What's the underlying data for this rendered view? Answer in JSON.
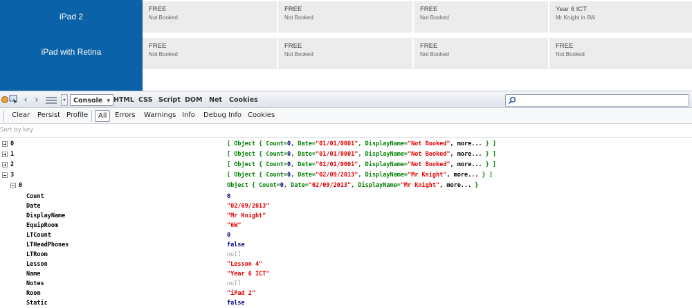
{
  "grid": {
    "devices": [
      {
        "name": "iPad 2",
        "cells": [
          {
            "status": "FREE",
            "sub": "Not Booked"
          },
          {
            "status": "FREE",
            "sub": "Not Booked"
          },
          {
            "status": "FREE",
            "sub": "Not Booked"
          },
          {
            "status": "Year 6 ICT",
            "sub": "Mr Knight in 6W"
          }
        ]
      },
      {
        "name": "iPad with Retina",
        "cells": [
          {
            "status": "FREE",
            "sub": "Not Booked"
          },
          {
            "status": "FREE",
            "sub": "Not Booked"
          },
          {
            "status": "FREE",
            "sub": "Not Booked"
          },
          {
            "status": "FREE",
            "sub": "Not Booked"
          }
        ]
      }
    ]
  },
  "toolbar": {
    "back_icon": "‹",
    "forward_icon": "›",
    "tabs": [
      "Console",
      "HTML",
      "CSS",
      "Script",
      "DOM",
      "Net",
      "Cookies"
    ],
    "console_dropdown": "▾"
  },
  "console_bar": {
    "buttons": [
      "Clear",
      "Persist",
      "Profile",
      "All",
      "Errors",
      "Warnings",
      "Info",
      "Debug Info",
      "Cookies"
    ]
  },
  "sort_label": "Sort by key",
  "tree": {
    "items": [
      {
        "key": "0",
        "summary": {
          "open": "[ ",
          "obj": "Object { ",
          "count_k": "Count=",
          "count_v": "0",
          "date_k": ",  Date=",
          "date_v": "\"01/01/0001\"",
          "dn_k": ",  DisplayName=",
          "dn_v": "\"Not Booked\"",
          "more": ",  more...",
          "close": " } ]"
        }
      },
      {
        "key": "1",
        "summary": {
          "open": "[ ",
          "obj": "Object { ",
          "count_k": "Count=",
          "count_v": "0",
          "date_k": ",  Date=",
          "date_v": "\"01/01/0001\"",
          "dn_k": ",  DisplayName=",
          "dn_v": "\"Not Booked\"",
          "more": ",  more...",
          "close": " } ]"
        }
      },
      {
        "key": "2",
        "summary": {
          "open": "[ ",
          "obj": "Object { ",
          "count_k": "Count=",
          "count_v": "0",
          "date_k": ",  Date=",
          "date_v": "\"01/01/0001\"",
          "dn_k": ",  DisplayName=",
          "dn_v": "\"Not Booked\"",
          "more": ",  more...",
          "close": " } ]"
        }
      },
      {
        "key": "3",
        "summary": {
          "open": "[ ",
          "obj": "Object { ",
          "count_k": "Count=",
          "count_v": "0",
          "date_k": ",  Date=",
          "date_v": "\"02/09/2013\"",
          "dn_k": ",  DisplayName=",
          "dn_v": "\"Mr Knight\"",
          "more": ",  more...",
          "close": " } ]"
        }
      }
    ],
    "expanded": {
      "key": "0",
      "summary": {
        "obj": "Object { ",
        "count_k": "Count=",
        "count_v": "0",
        "date_k": ",  Date=",
        "date_v": "\"02/09/2013\"",
        "dn_k": ",  DisplayName=",
        "dn_v": "\"Mr Knight\"",
        "more": ",  more...",
        "close": " }"
      },
      "props": [
        {
          "key": "Count",
          "value": "0",
          "type": "num"
        },
        {
          "key": "Date",
          "value": "\"02/09/2013\"",
          "type": "str"
        },
        {
          "key": "DisplayName",
          "value": "\"Mr Knight\"",
          "type": "str"
        },
        {
          "key": "EquipRoom",
          "value": "\"6W\"",
          "type": "str"
        },
        {
          "key": "LTCount",
          "value": "0",
          "type": "num"
        },
        {
          "key": "LTHeadPhones",
          "value": "false",
          "type": "kw"
        },
        {
          "key": "LTRoom",
          "value": "null",
          "type": "nul"
        },
        {
          "key": "Lesson",
          "value": "\"Lesson 4\"",
          "type": "str"
        },
        {
          "key": "Name",
          "value": "\"Year 6 ICT\"",
          "type": "str"
        },
        {
          "key": "Notes",
          "value": "null",
          "type": "nul"
        },
        {
          "key": "Room",
          "value": "\"iPad 2\"",
          "type": "str"
        },
        {
          "key": "Static",
          "value": "false",
          "type": "kw"
        }
      ]
    }
  }
}
